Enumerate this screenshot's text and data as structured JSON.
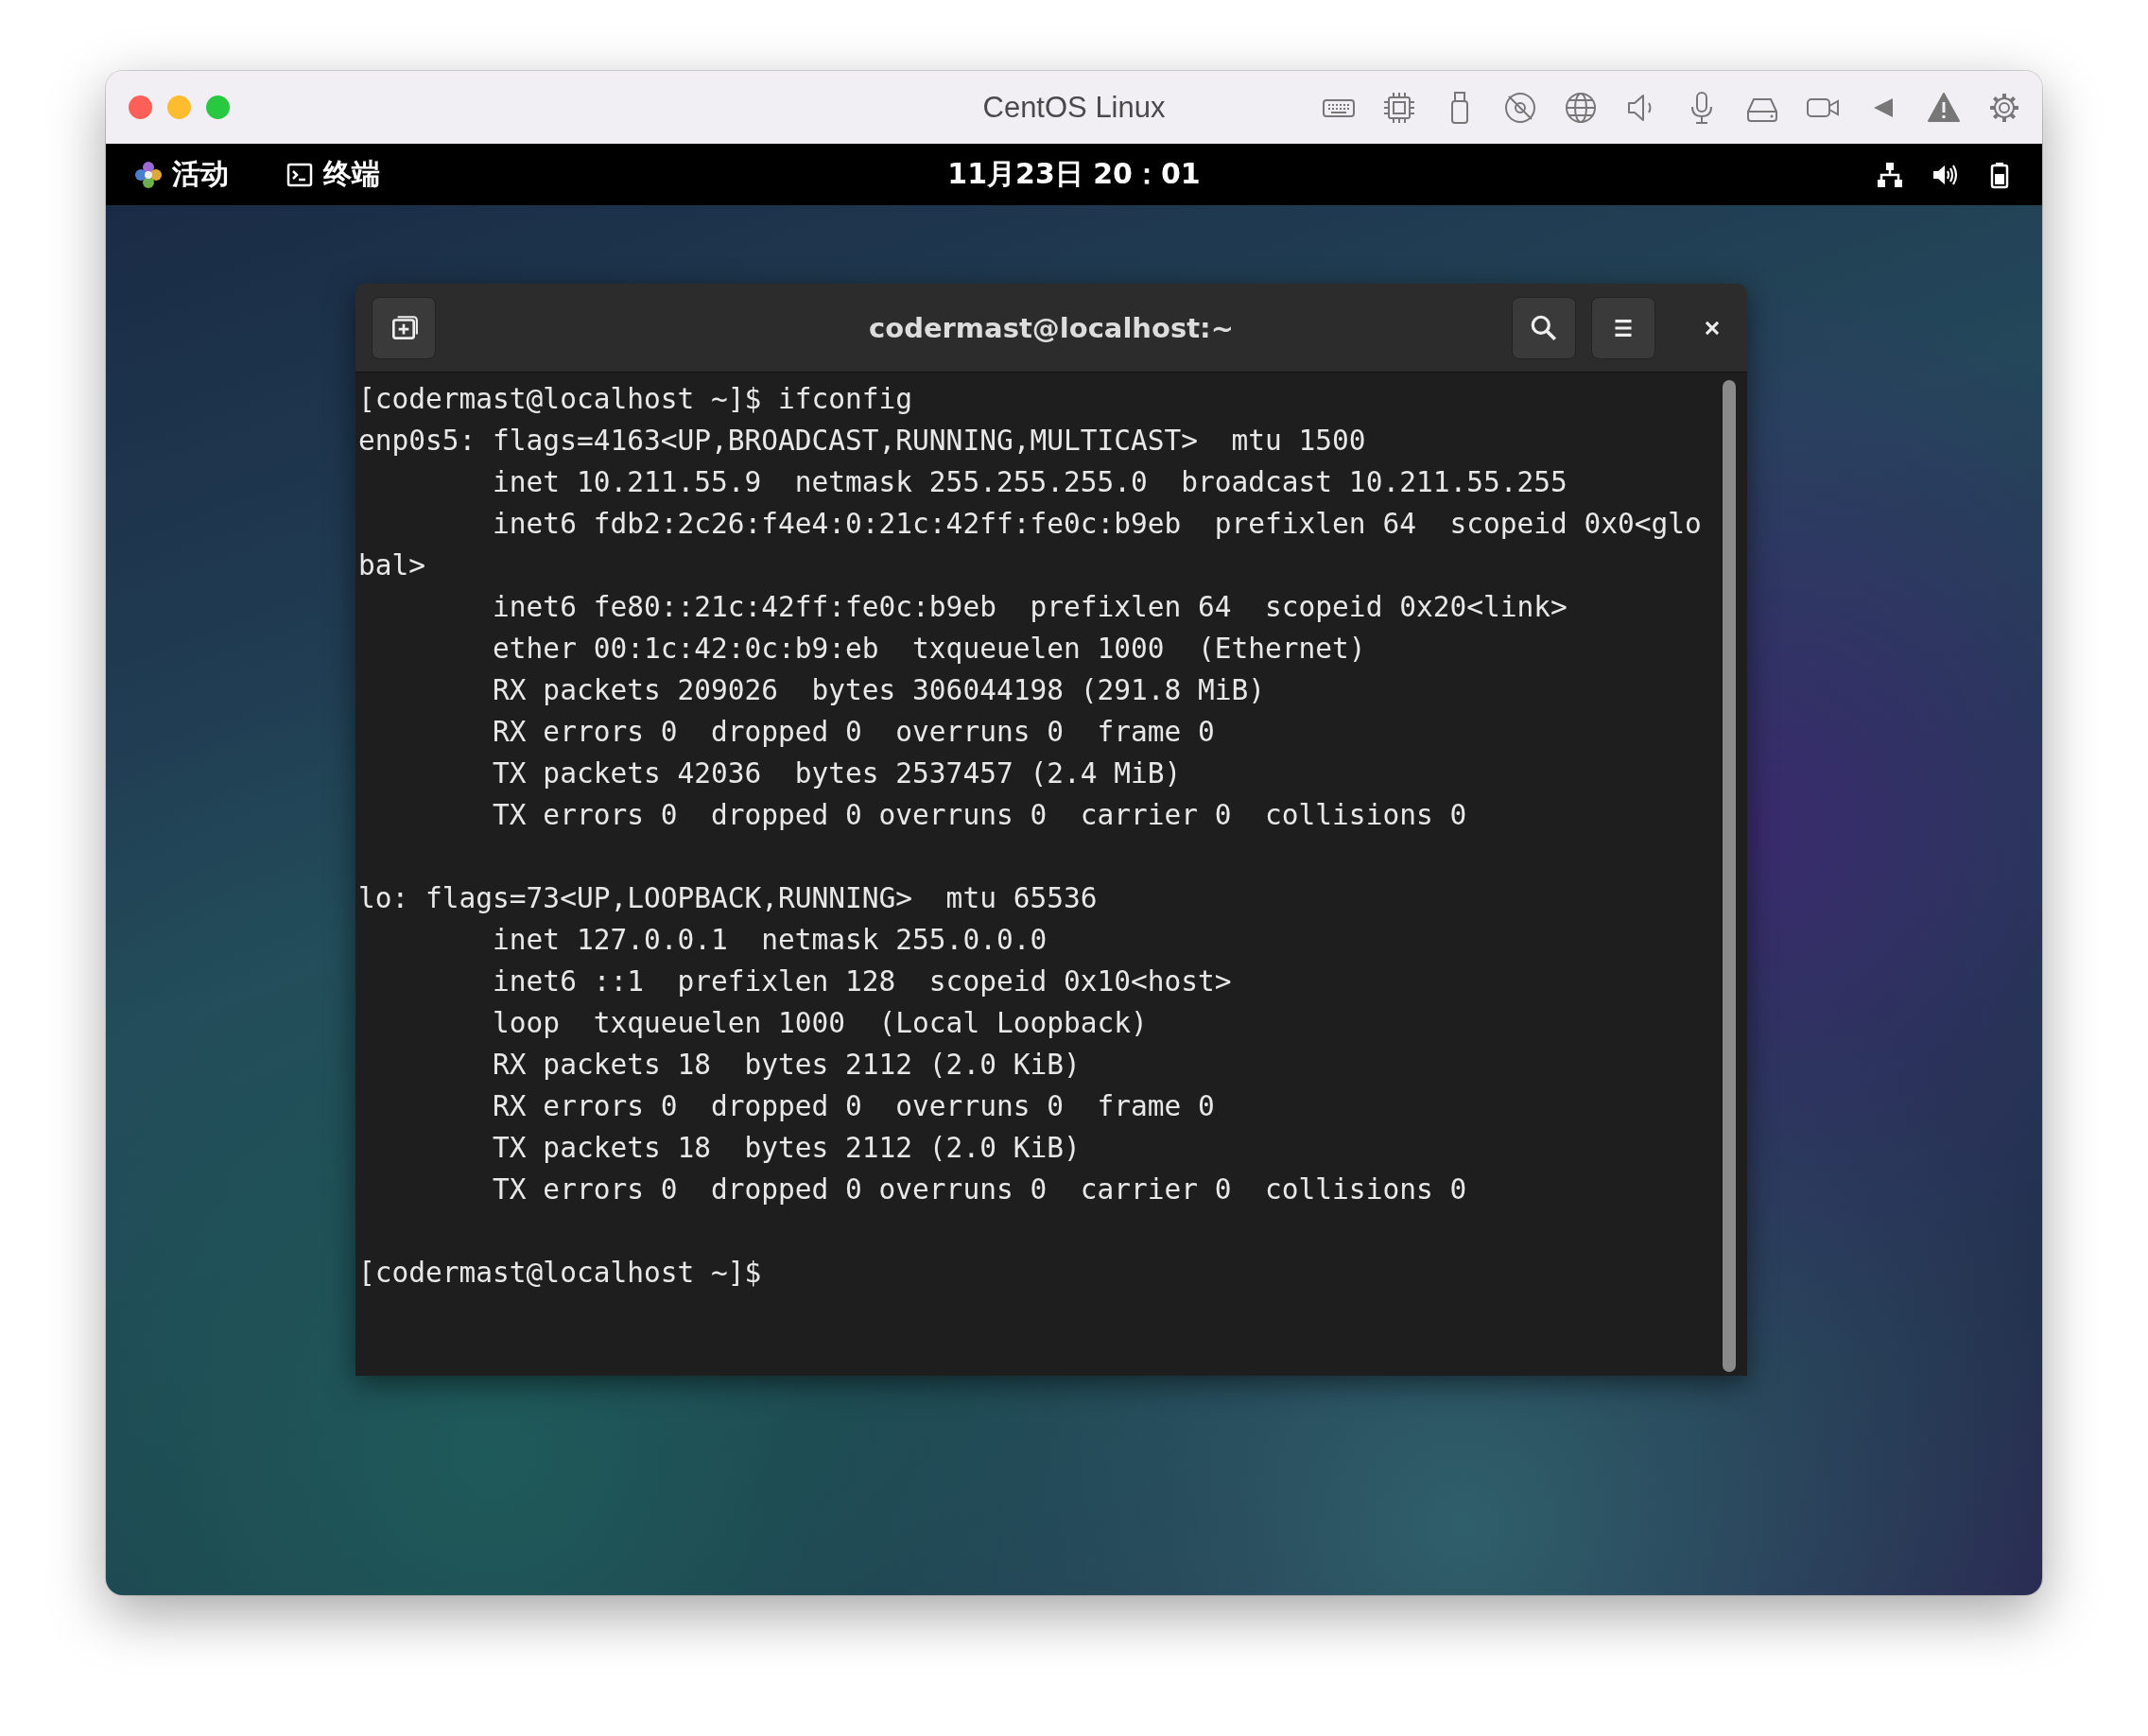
{
  "window": {
    "title": "CentOS Linux"
  },
  "top_bar": {
    "activities": "活动",
    "app": "终端",
    "clock": "11月23日 20：01"
  },
  "terminal": {
    "title": "codermast@localhost:~",
    "blocks": [
      {
        "lines": [
          "[codermast@localhost ~]$ ifconfig",
          "enp0s5: flags=4163<UP,BROADCAST,RUNNING,MULTICAST>  mtu 1500",
          "        inet 10.211.55.9  netmask 255.255.255.0  broadcast 10.211.55.255",
          "        inet6 fdb2:2c26:f4e4:0:21c:42ff:fe0c:b9eb  prefixlen 64  scopeid 0x0<glo",
          "bal>",
          "        inet6 fe80::21c:42ff:fe0c:b9eb  prefixlen 64  scopeid 0x20<link>",
          "        ether 00:1c:42:0c:b9:eb  txqueuelen 1000  (Ethernet)",
          "        RX packets 209026  bytes 306044198 (291.8 MiB)",
          "        RX errors 0  dropped 0  overruns 0  frame 0",
          "        TX packets 42036  bytes 2537457 (2.4 MiB)",
          "        TX errors 0  dropped 0 overruns 0  carrier 0  collisions 0"
        ]
      },
      {
        "lines": [
          "lo: flags=73<UP,LOOPBACK,RUNNING>  mtu 65536",
          "        inet 127.0.0.1  netmask 255.0.0.0",
          "        inet6 ::1  prefixlen 128  scopeid 0x10<host>",
          "        loop  txqueuelen 1000  (Local Loopback)",
          "        RX packets 18  bytes 2112 (2.0 KiB)",
          "        RX errors 0  dropped 0  overruns 0  frame 0",
          "        TX packets 18  bytes 2112 (2.0 KiB)",
          "        TX errors 0  dropped 0 overruns 0  carrier 0  collisions 0"
        ]
      },
      {
        "lines": [
          "[codermast@localhost ~]$"
        ]
      }
    ]
  }
}
